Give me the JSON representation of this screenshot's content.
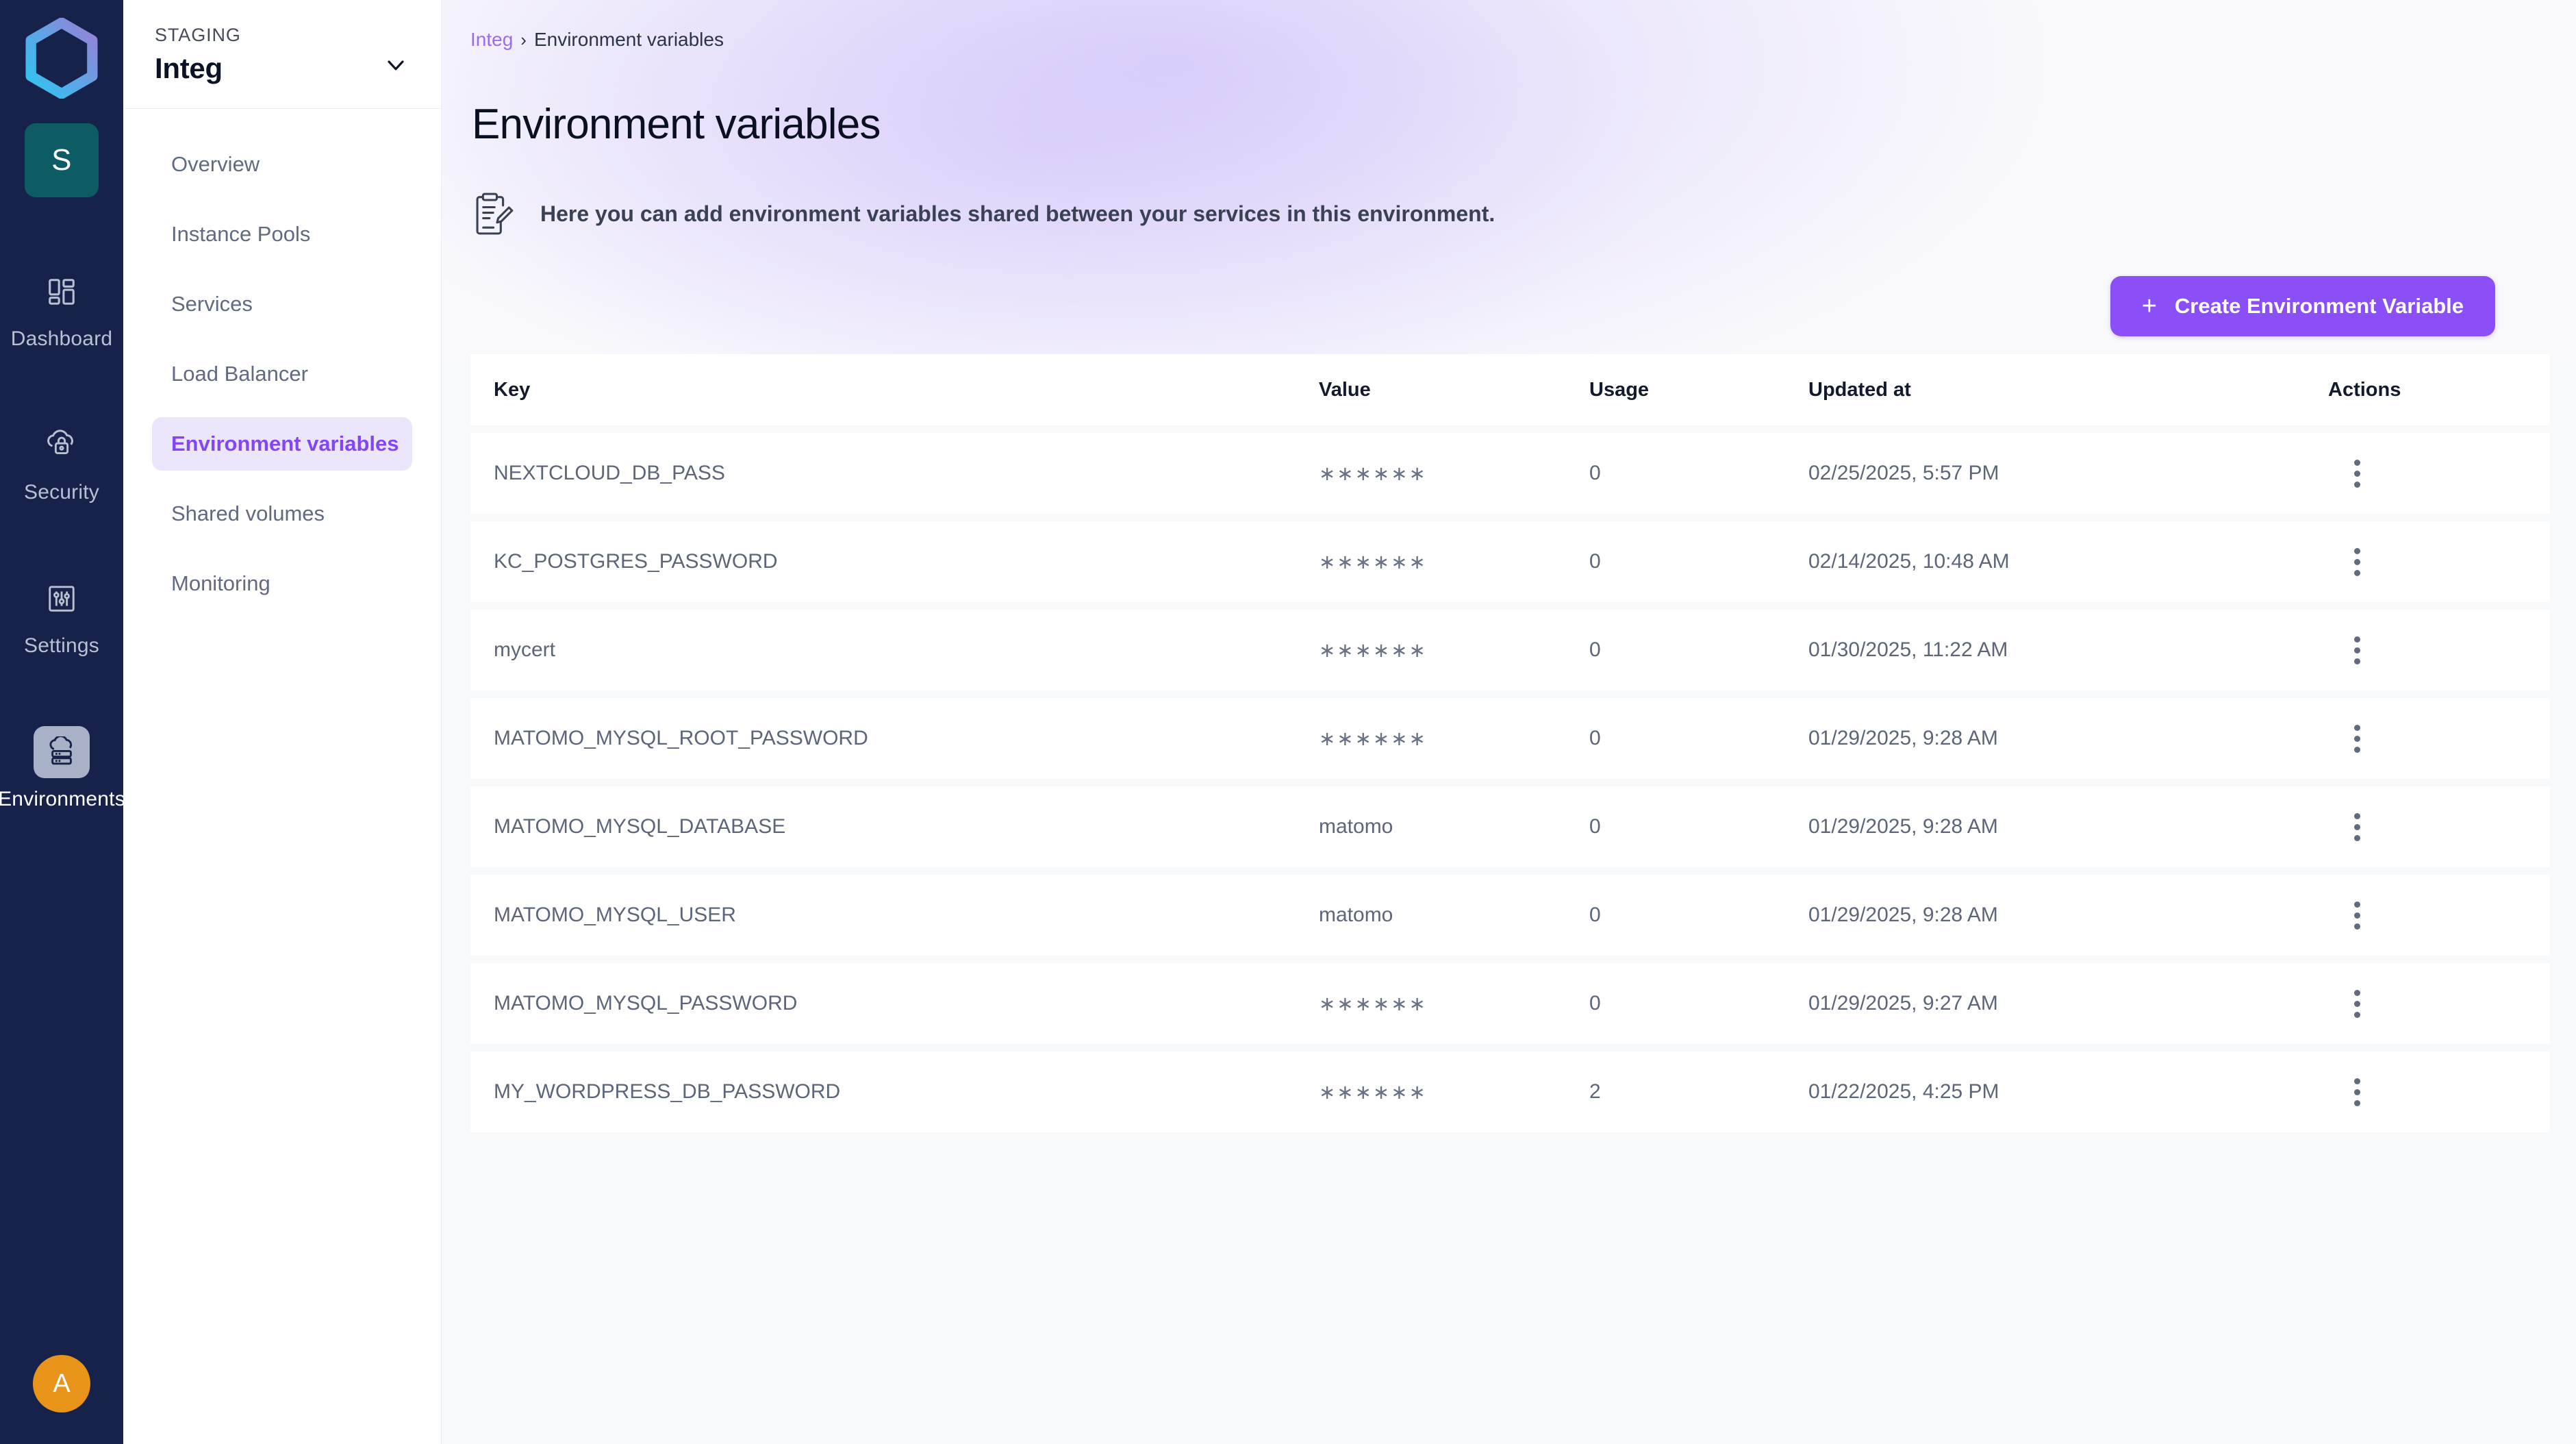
{
  "rail": {
    "logo_icon": "hexagon-logo-icon",
    "env_badge": {
      "letter": "S",
      "name": "environment-badge",
      "color": "#0d5c64"
    },
    "items": [
      {
        "label": "Dashboard",
        "icon": "dashboard-icon",
        "active": false
      },
      {
        "label": "Security",
        "icon": "cloud-lock-icon",
        "active": false
      },
      {
        "label": "Settings",
        "icon": "sliders-icon",
        "active": false
      },
      {
        "label": "Environments",
        "icon": "cloud-server-icon",
        "active": true
      }
    ],
    "avatar": {
      "letter": "A",
      "color": "#e8941a"
    }
  },
  "subnav": {
    "kicker": "STAGING",
    "title": "Integ",
    "chevron_icon": "chevron-down-icon",
    "items": [
      {
        "label": "Overview",
        "active": false
      },
      {
        "label": "Instance Pools",
        "active": false
      },
      {
        "label": "Services",
        "active": false
      },
      {
        "label": "Load Balancer",
        "active": false
      },
      {
        "label": "Environment variables",
        "active": true
      },
      {
        "label": "Shared volumes",
        "active": false
      },
      {
        "label": "Monitoring",
        "active": false
      }
    ]
  },
  "breadcrumb": {
    "parent": "Integ",
    "separator": "›",
    "current": "Environment variables"
  },
  "page": {
    "title": "Environment variables",
    "description": "Here you can add environment variables shared between your services in this environment.",
    "description_icon": "clipboard-pencil-icon"
  },
  "cta": {
    "label": "Create Environment Variable",
    "icon": "plus-icon",
    "color": "#8a4ff6"
  },
  "table": {
    "columns": [
      "Key",
      "Value",
      "Usage",
      "Updated at",
      "Actions"
    ],
    "row_action_icon": "kebab-menu-icon",
    "rows": [
      {
        "key": "NEXTCLOUD_DB_PASS",
        "value": "∗∗∗∗∗∗",
        "usage": "0",
        "updated_at": "02/25/2025, 5:57 PM"
      },
      {
        "key": "KC_POSTGRES_PASSWORD",
        "value": "∗∗∗∗∗∗",
        "usage": "0",
        "updated_at": "02/14/2025, 10:48 AM"
      },
      {
        "key": "mycert",
        "value": "∗∗∗∗∗∗",
        "usage": "0",
        "updated_at": "01/30/2025, 11:22 AM"
      },
      {
        "key": "MATOMO_MYSQL_ROOT_PASSWORD",
        "value": "∗∗∗∗∗∗",
        "usage": "0",
        "updated_at": "01/29/2025, 9:28 AM"
      },
      {
        "key": "MATOMO_MYSQL_DATABASE",
        "value": "matomo",
        "usage": "0",
        "updated_at": "01/29/2025, 9:28 AM"
      },
      {
        "key": "MATOMO_MYSQL_USER",
        "value": "matomo",
        "usage": "0",
        "updated_at": "01/29/2025, 9:28 AM"
      },
      {
        "key": "MATOMO_MYSQL_PASSWORD",
        "value": "∗∗∗∗∗∗",
        "usage": "0",
        "updated_at": "01/29/2025, 9:27 AM"
      },
      {
        "key": "MY_WORDPRESS_DB_PASSWORD",
        "value": "∗∗∗∗∗∗",
        "usage": "2",
        "updated_at": "01/22/2025, 4:25 PM"
      }
    ]
  }
}
